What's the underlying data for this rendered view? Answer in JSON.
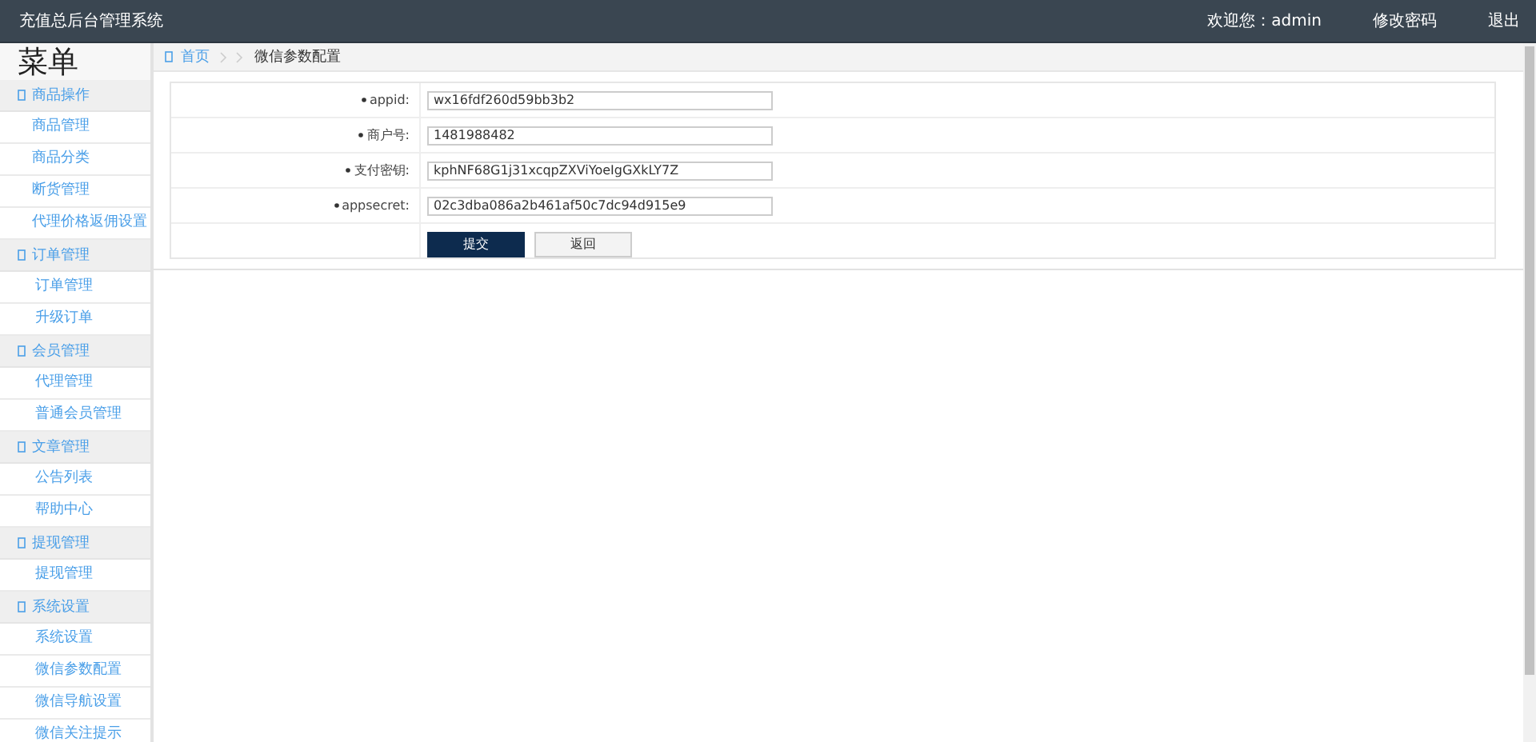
{
  "header": {
    "title": "充值总后台管理系统",
    "welcome": "欢迎您：admin",
    "links": [
      "修改密码",
      "退出"
    ]
  },
  "sidebar": {
    "heading": "菜单",
    "groups": [
      {
        "label": "商品操作",
        "items": [
          "商品管理",
          "商品分类",
          "断货管理",
          "代理价格返佣设置"
        ]
      },
      {
        "label": "订单管理",
        "items": [
          "订单管理",
          "升级订单"
        ]
      },
      {
        "label": "会员管理",
        "items": [
          "代理管理",
          "普通会员管理"
        ]
      },
      {
        "label": "文章管理",
        "items": [
          "公告列表",
          "帮助中心"
        ]
      },
      {
        "label": "提现管理",
        "items": [
          "提现管理"
        ]
      },
      {
        "label": "系统设置",
        "items": [
          "系统设置",
          "微信参数配置",
          "微信导航设置",
          "微信关注提示"
        ]
      }
    ]
  },
  "breadcrumb": [
    "首页",
    "微信参数配置"
  ],
  "form": {
    "fields": [
      {
        "label": "appid:",
        "value": "wx16fdf260d59bb3b2"
      },
      {
        "label": "商户号:",
        "value": "1481988482"
      },
      {
        "label": "支付密钥:",
        "value": "kphNF68G1j31xcqpZXViYoeIgGXkLY7Z"
      },
      {
        "label": "appsecret:",
        "value": "02c3dba086a2b461af50c7dc94d915e9"
      }
    ],
    "buttons": [
      {
        "label": "提交",
        "kind": "primary"
      },
      {
        "label": "返回",
        "kind": "secondary"
      }
    ]
  }
}
